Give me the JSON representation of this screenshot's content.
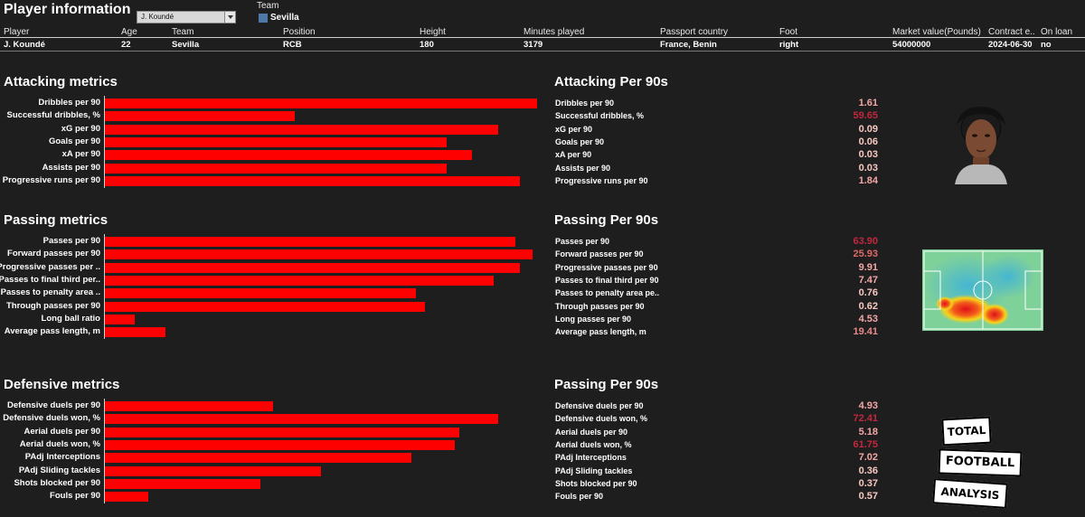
{
  "header": {
    "title": "Player information",
    "player_select": "J. Koundé",
    "team_filter_label": "Team",
    "team_filter_value": "Sevilla",
    "columns": [
      "Player",
      "Age",
      "Team",
      "Position",
      "Height",
      "Minutes played",
      "Passport country",
      "Foot",
      "Market value(Pounds)",
      "Contract e..",
      "On loan"
    ],
    "row": [
      "J. Koundé",
      "22",
      "Sevilla",
      "RCB",
      "180",
      "3179",
      "France, Benin",
      "right",
      "54000000",
      "2024-06-30",
      "no"
    ]
  },
  "sections": [
    {
      "title": "Attacking metrics",
      "right_title": "Attacking Per 90s",
      "metrics": [
        {
          "label": "Dribbles per 90",
          "bar": 1.0
        },
        {
          "label": "Successful dribbles, %",
          "bar": 0.44
        },
        {
          "label": "xG per 90",
          "bar": 0.91
        },
        {
          "label": "Goals per 90",
          "bar": 0.79
        },
        {
          "label": "xA per 90",
          "bar": 0.85
        },
        {
          "label": "Assists per 90",
          "bar": 0.79
        },
        {
          "label": "Progressive runs per 90",
          "bar": 0.96
        }
      ],
      "per90": [
        {
          "label": "Dribbles per 90",
          "value": "1.61",
          "color": "#f4a6a6"
        },
        {
          "label": "Successful dribbles, %",
          "value": "59.65",
          "color": "#c0283f"
        },
        {
          "label": "xG per 90",
          "value": "0.09",
          "color": "#f6c8c0"
        },
        {
          "label": "Goals per 90",
          "value": "0.06",
          "color": "#f6c8c0"
        },
        {
          "label": "xA per 90",
          "value": "0.03",
          "color": "#f6c8c0"
        },
        {
          "label": "Assists per 90",
          "value": "0.03",
          "color": "#f6c8c0"
        },
        {
          "label": "Progressive runs per 90",
          "value": "1.84",
          "color": "#f4a6a6"
        }
      ]
    },
    {
      "title": "Passing metrics",
      "right_title": "Passing Per 90s",
      "metrics": [
        {
          "label": "Passes per 90",
          "bar": 0.95
        },
        {
          "label": "Forward passes per 90",
          "bar": 0.99
        },
        {
          "label": "Progressive passes per ..",
          "bar": 0.96
        },
        {
          "label": "Passes to final third per..",
          "bar": 0.9
        },
        {
          "label": "Passes to penalty area ..",
          "bar": 0.72
        },
        {
          "label": "Through passes per 90",
          "bar": 0.74
        },
        {
          "label": "Long ball ratio",
          "bar": 0.07
        },
        {
          "label": "Average pass length, m",
          "bar": 0.14
        }
      ],
      "per90": [
        {
          "label": "Passes per 90",
          "value": "63.90",
          "color": "#c0283f"
        },
        {
          "label": "Forward passes per 90",
          "value": "25.93",
          "color": "#e06a6a"
        },
        {
          "label": "Progressive passes per 90",
          "value": "9.91",
          "color": "#f4a6a6"
        },
        {
          "label": "Passes to final third per 90",
          "value": "7.47",
          "color": "#f4a6a6"
        },
        {
          "label": "Passes to penalty area pe..",
          "value": "0.76",
          "color": "#f6c8c0"
        },
        {
          "label": "Through passes per 90",
          "value": "0.62",
          "color": "#f6c8c0"
        },
        {
          "label": "Long passes per 90",
          "value": "4.53",
          "color": "#f4a6a6"
        },
        {
          "label": "Average pass length, m",
          "value": "19.41",
          "color": "#e88a8a"
        }
      ]
    },
    {
      "title": "Defensive metrics",
      "right_title": "Passing Per 90s",
      "metrics": [
        {
          "label": "Defensive duels per 90",
          "bar": 0.39
        },
        {
          "label": "Defensive duels won, %",
          "bar": 0.91
        },
        {
          "label": "Aerial duels per 90",
          "bar": 0.82
        },
        {
          "label": "Aerial duels won, %",
          "bar": 0.81
        },
        {
          "label": "PAdj Interceptions",
          "bar": 0.71
        },
        {
          "label": "PAdj Sliding tackles",
          "bar": 0.5
        },
        {
          "label": "Shots blocked per 90",
          "bar": 0.36
        },
        {
          "label": "Fouls per 90",
          "bar": 0.1
        }
      ],
      "per90": [
        {
          "label": "Defensive duels per 90",
          "value": "4.93",
          "color": "#f4a6a6"
        },
        {
          "label": "Defensive duels won, %",
          "value": "72.41",
          "color": "#c0283f"
        },
        {
          "label": "Aerial duels per 90",
          "value": "5.18",
          "color": "#f4a6a6"
        },
        {
          "label": "Aerial duels won, %",
          "value": "61.75",
          "color": "#c0283f"
        },
        {
          "label": "PAdj Interceptions",
          "value": "7.02",
          "color": "#f4a6a6"
        },
        {
          "label": "PAdj Sliding tackles",
          "value": "0.36",
          "color": "#f6c8c0"
        },
        {
          "label": "Shots blocked per 90",
          "value": "0.37",
          "color": "#f6c8c0"
        },
        {
          "label": "Fouls per 90",
          "value": "0.57",
          "color": "#f6c8c0"
        }
      ]
    }
  ],
  "logo": {
    "line1": "TOTAL",
    "line2": "FOOTBALL",
    "line3": "ANALYSIS"
  },
  "colors": {
    "bar": "#ff0000",
    "background": "#1e1e1e",
    "pitch": "#7fd19a"
  }
}
